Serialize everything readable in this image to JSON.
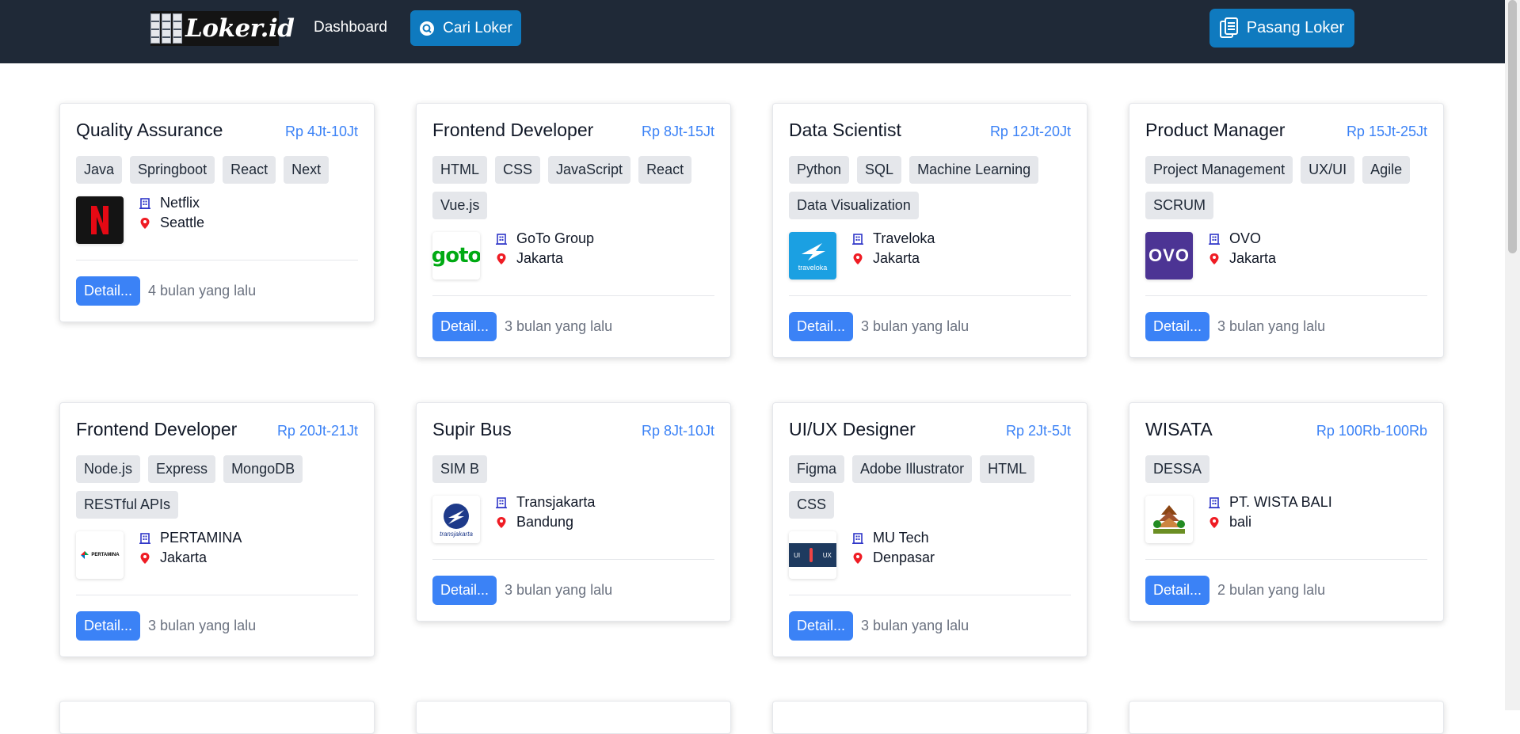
{
  "nav": {
    "logo_text": "Loker.id",
    "dashboard": "Dashboard",
    "cari_loker": "Cari Loker",
    "pasang_loker": "Pasang Loker"
  },
  "colors": {
    "navbar": "#1f2937",
    "primary_button": "#0f7abf",
    "detail_button": "#3b82f6",
    "salary": "#3b82f6"
  },
  "jobs": [
    {
      "title": "Quality Assurance",
      "salary": "Rp 4Jt-10Jt",
      "tags": [
        "Java",
        "Springboot",
        "React",
        "Next"
      ],
      "company": "Netflix",
      "location": "Seattle",
      "detail": "Detail...",
      "posted": "4 bulan yang lalu",
      "logo_icon": "netflix-logo"
    },
    {
      "title": "Frontend Developer",
      "salary": "Rp 8Jt-15Jt",
      "tags": [
        "HTML",
        "CSS",
        "JavaScript",
        "React",
        "Vue.js"
      ],
      "company": "GoTo Group",
      "location": "Jakarta",
      "detail": "Detail...",
      "posted": "3 bulan yang lalu",
      "logo_icon": "goto-logo",
      "logo_text": "goto"
    },
    {
      "title": "Data Scientist",
      "salary": "Rp 12Jt-20Jt",
      "tags": [
        "Python",
        "SQL",
        "Machine Learning",
        "Data Visualization"
      ],
      "company": "Traveloka",
      "location": "Jakarta",
      "detail": "Detail...",
      "posted": "3 bulan yang lalu",
      "logo_icon": "traveloka-logo",
      "logo_text": "traveloka"
    },
    {
      "title": "Product Manager",
      "salary": "Rp 15Jt-25Jt",
      "tags": [
        "Project Management",
        "UX/UI",
        "Agile",
        "SCRUM"
      ],
      "company": "OVO",
      "location": "Jakarta",
      "detail": "Detail...",
      "posted": "3 bulan yang lalu",
      "logo_icon": "ovo-logo",
      "logo_text": "OVO"
    },
    {
      "title": "Frontend Developer",
      "salary": "Rp 20Jt-21Jt",
      "tags": [
        "Node.js",
        "Express",
        "MongoDB",
        "RESTful APIs"
      ],
      "company": "PERTAMINA",
      "location": "Jakarta",
      "detail": "Detail...",
      "posted": "3 bulan yang lalu",
      "logo_icon": "pertamina-logo",
      "logo_text": "PERTAMINA"
    },
    {
      "title": "Supir Bus",
      "salary": "Rp 8Jt-10Jt",
      "tags": [
        "SIM B"
      ],
      "company": "Transjakarta",
      "location": "Bandung",
      "detail": "Detail...",
      "posted": "3 bulan yang lalu",
      "logo_icon": "transjakarta-logo",
      "logo_text": "transjakarta"
    },
    {
      "title": "UI/UX Designer",
      "salary": "Rp 2Jt-5Jt",
      "tags": [
        "Figma",
        "Adobe Illustrator",
        "HTML",
        "CSS"
      ],
      "company": "MU Tech",
      "location": "Denpasar",
      "detail": "Detail...",
      "posted": "3 bulan yang lalu",
      "logo_icon": "mutech-logo",
      "logo_text_left": "UI",
      "logo_text_right": "UX"
    },
    {
      "title": "WISATA",
      "salary": "Rp 100Rb-100Rb",
      "tags": [
        "DESSA"
      ],
      "company": "PT. WISTA BALI",
      "location": "bali",
      "detail": "Detail...",
      "posted": "2 bulan yang lalu",
      "logo_icon": "bali-temple-logo"
    }
  ]
}
